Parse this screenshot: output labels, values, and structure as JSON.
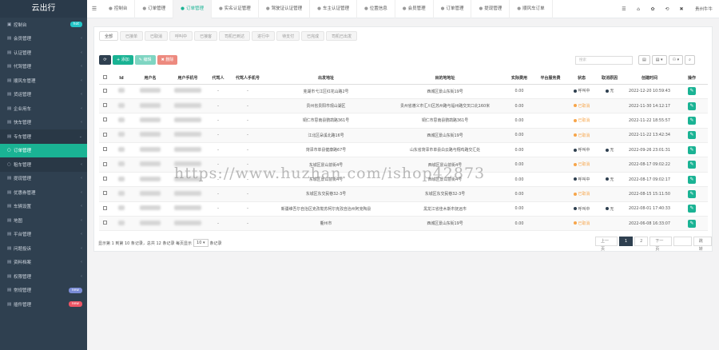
{
  "app": {
    "title": "云出行"
  },
  "sidebar": {
    "items": [
      {
        "icon": "▣",
        "label": "控制台",
        "badge": "hot",
        "badge_color": "#23c6c8"
      },
      {
        "icon": "▤",
        "label": "会员管理",
        "arrow": "‹"
      },
      {
        "icon": "▤",
        "label": "认证管理",
        "arrow": "‹"
      },
      {
        "icon": "▤",
        "label": "代驾管理",
        "arrow": "‹"
      },
      {
        "icon": "▤",
        "label": "顺风车管理",
        "arrow": "‹"
      },
      {
        "icon": "▤",
        "label": "货运管理",
        "arrow": "‹"
      },
      {
        "icon": "▤",
        "label": "企业用车",
        "arrow": "‹"
      },
      {
        "icon": "▤",
        "label": "快车管理",
        "arrow": "‹"
      },
      {
        "icon": "▤",
        "label": "专车管理",
        "arrow": "⌄",
        "state": "open"
      },
      {
        "icon": "○",
        "label": "订单管理",
        "state": "sub"
      },
      {
        "icon": "○",
        "label": "租车管理",
        "arrow": "‹",
        "state": "child"
      },
      {
        "icon": "▤",
        "label": "提现管理",
        "arrow": "‹"
      },
      {
        "icon": "▤",
        "label": "优惠券管理",
        "arrow": "‹"
      },
      {
        "icon": "▤",
        "label": "车辆设置",
        "arrow": "‹"
      },
      {
        "icon": "▤",
        "label": "地图",
        "arrow": "‹"
      },
      {
        "icon": "▤",
        "label": "平台管理",
        "arrow": "‹"
      },
      {
        "icon": "▤",
        "label": "问题投诉",
        "arrow": "‹"
      },
      {
        "icon": "▤",
        "label": "资料档案",
        "arrow": "‹"
      },
      {
        "icon": "▤",
        "label": "权限管理",
        "arrow": "‹"
      },
      {
        "icon": "▤",
        "label": "常规管理",
        "badge": "new",
        "badge_color": "#7a8cd6"
      },
      {
        "icon": "▤",
        "label": "插件管理",
        "badge": "new",
        "badge_color": "#ed5565"
      }
    ]
  },
  "topbar": {
    "tabs": [
      {
        "label": "控制台"
      },
      {
        "label": "订单管理"
      },
      {
        "label": "订单管理",
        "active": true
      },
      {
        "label": "实名认证管理"
      },
      {
        "label": "驾驶证认证管理"
      },
      {
        "label": "车主认证管理"
      },
      {
        "label": "位置信息"
      },
      {
        "label": "会员管理"
      },
      {
        "label": "订单管理"
      },
      {
        "label": "提现管理"
      },
      {
        "label": "顺风车订单"
      }
    ],
    "icons": [
      "☰",
      "⌂",
      "✿",
      "⟲",
      "✖"
    ],
    "user": "贵州牛牛"
  },
  "subtabs": [
    "全部",
    "已接单",
    "已取消",
    "呼叫中",
    "已接客",
    "司机已到达",
    "进行中",
    "待支付",
    "已完成",
    "司机已出发"
  ],
  "toolbar": {
    "refresh": "⟳",
    "add": "+ 添加",
    "edit": "✎ 编辑",
    "delete": "✖ 删除"
  },
  "search": {
    "placeholder": "搜索"
  },
  "tools": [
    "▤",
    "▤ ▾",
    "⚇ ▾",
    "⌕"
  ],
  "table": {
    "columns": [
      "",
      "Id",
      "用户名",
      "用户手机号",
      "代驾人",
      "代驾人手机号",
      "出发地址",
      "目的地地址",
      "实际费用",
      "平台服务费",
      "状态",
      "取消原因",
      "创建时间",
      "操作"
    ],
    "rows": [
      {
        "start": "芜湖市弋江区红花山路2号",
        "end": "西城区景山东街19号",
        "fee": "0.00",
        "status": "呼叫中",
        "status_type": "call",
        "reason": "无",
        "time": "2022-12-20 10:59:43"
      },
      {
        "start": "贵州省贵阳市观山湖区",
        "end": "贵州省遵义市汇川区苏州路与福州路交叉口北160米",
        "fee": "0.00",
        "status": "已取消",
        "status_type": "cancel",
        "reason": "",
        "time": "2022-11-30 14:12:17"
      },
      {
        "start": "铜仁市思南县鹦鹉路361号",
        "end": "铜仁市思南县鹦鹉路361号",
        "fee": "0.00",
        "status": "已取消",
        "status_type": "cancel",
        "reason": "",
        "time": "2022-11-22 18:55:57"
      },
      {
        "start": "江北区朵溪北路16号",
        "end": "西城区景山东街19号",
        "fee": "0.00",
        "status": "已取消",
        "status_type": "cancel",
        "reason": "",
        "time": "2022-11-22 13:42:34"
      },
      {
        "start": "菏泽市单县健康路67号",
        "end": "山东省菏泽市单县白云路与翔鸡路交汇处",
        "fee": "0.00",
        "status": "呼叫中",
        "status_type": "call",
        "reason": "无",
        "time": "2022-09-26 23:01:31"
      },
      {
        "start": "东城区景山前街4号",
        "end": "西城区景山前街4号",
        "fee": "0.00",
        "status": "已取消",
        "status_type": "cancel",
        "reason": "",
        "time": "2022-08-17 09:02:22"
      },
      {
        "start": "东城区景山前街4号",
        "end": "西城区景山前街4号",
        "fee": "0.00",
        "status": "呼叫中",
        "status_type": "call",
        "reason": "无",
        "time": "2022-08-17 09:02:17"
      },
      {
        "start": "东城区东交民巷32-3号",
        "end": "东城区东交民巷32-3号",
        "fee": "0.00",
        "status": "已取消",
        "status_type": "cancel",
        "reason": "",
        "time": "2022-08-15 15:11:50"
      },
      {
        "start": "新疆维吾尔自治区克孜勒苏柯尔克孜自治州阿克陶县",
        "end": "黑龙江省佳木斯市抚远市",
        "fee": "0.00",
        "status": "呼叫中",
        "status_type": "call",
        "reason": "无",
        "time": "2022-08-01 17:40:33"
      },
      {
        "start": "衢州市",
        "end": "西城区景山东街19号",
        "fee": "0.00",
        "status": "已取消",
        "status_type": "cancel",
        "reason": "",
        "time": "2022-06-08 16:33:07"
      }
    ]
  },
  "footer": {
    "text_before": "显示第 1 到第 10 条记录，总共 12 条记录 每页显示",
    "page_size": "10 ▾",
    "text_after": "条记录"
  },
  "pager": {
    "prev": "上一页",
    "pages": [
      "1",
      "2"
    ],
    "next": "下一页",
    "jump": "跳转"
  },
  "watermark": "https://www.huzhan.com/ishop42873"
}
